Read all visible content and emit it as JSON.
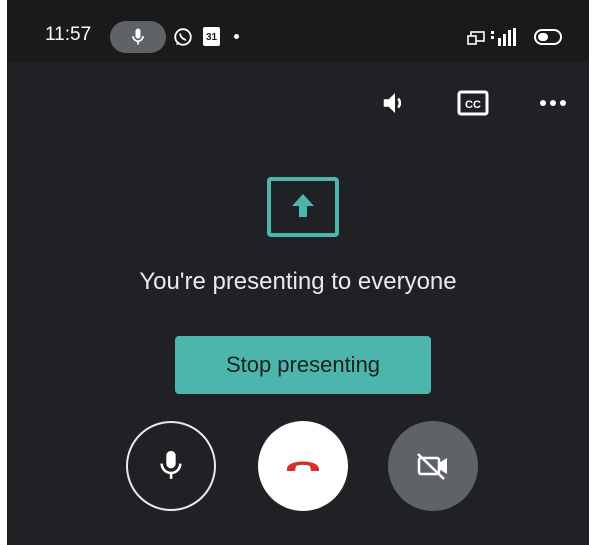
{
  "status_bar": {
    "time": "11:57",
    "calendar_day": "31",
    "icons": [
      "mic-active-icon",
      "whatsapp-icon",
      "calendar-icon",
      "notification-dot",
      "cast-icon",
      "signal-icon",
      "battery-icon"
    ]
  },
  "top_bar": {
    "icons": [
      "volume-icon",
      "closed-captions-icon",
      "more-options-icon"
    ]
  },
  "presenting": {
    "message": "You're presenting to everyone",
    "stop_label": "Stop presenting",
    "icon": "present-screen-icon"
  },
  "controls": {
    "icons": [
      "microphone-icon",
      "end-call-icon",
      "camera-off-icon"
    ]
  },
  "colors": {
    "background": "#202124",
    "accent": "#4db6ac",
    "end_call_red": "#d93025",
    "control_grey": "#5f6368"
  }
}
